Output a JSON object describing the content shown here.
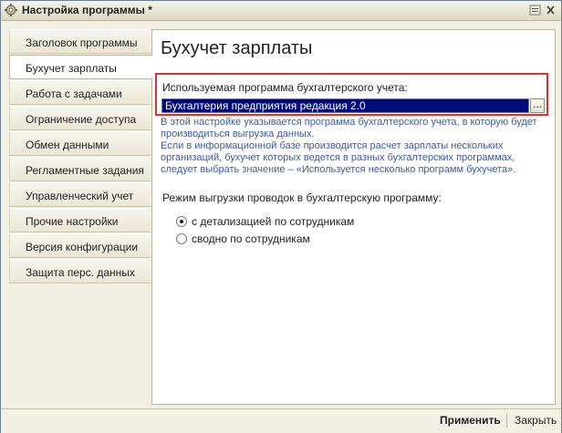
{
  "window": {
    "title": "Настройка программы *",
    "icons": [
      "gear-icon",
      "menu-icon",
      "close-icon"
    ]
  },
  "sidebar": {
    "items": [
      {
        "label": "Заголовок программы"
      },
      {
        "label": "Бухучет зарплаты"
      },
      {
        "label": "Работа с задачами"
      },
      {
        "label": "Ограничение доступа"
      },
      {
        "label": "Обмен данными"
      },
      {
        "label": "Регламентные задания"
      },
      {
        "label": "Управленческий учет"
      },
      {
        "label": "Прочие настройки"
      },
      {
        "label": "Версия конфигурации"
      },
      {
        "label": "Защита перс. данных"
      }
    ],
    "active_index": 1
  },
  "main": {
    "heading": "Бухучет зарплаты",
    "field_label": "Используемая программа бухгалтерского учета:",
    "field_value": "Бухгалтерия предприятия редакция 2.0",
    "field_button": "...",
    "hint_lines": [
      "В этой настройке указывается программа бухгалтерского учета, в которую будет",
      "производиться выгрузка данных.",
      "Если в информационной базе производится расчет зарплаты нескольких",
      "организаций, бухучет которых ведется в разных бухгалтерских программах,",
      "следует выбрать значение – «Используется несколько программ бухучета»."
    ],
    "mode_label": "Режим выгрузки проводок в бухгалтерскую программу:",
    "radio_options": [
      {
        "label": "с детализацией по сотрудникам",
        "checked": true
      },
      {
        "label": "сводно по сотрудникам",
        "checked": false
      }
    ]
  },
  "footer": {
    "apply_label": "Применить",
    "close_label": "Закрыть"
  },
  "colors": {
    "selection": "#000a7a",
    "hint_text": "#3b5aa6",
    "highlight_border": "#e03030"
  }
}
